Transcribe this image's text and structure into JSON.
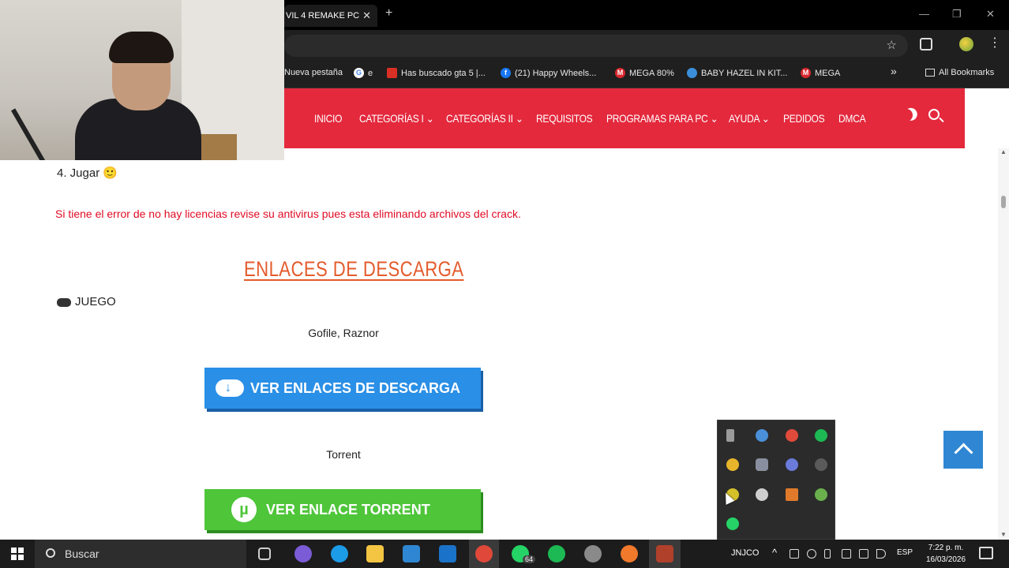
{
  "browser": {
    "tab_title": "VIL 4 REMAKE PC",
    "tab_close": "✕",
    "new_tab": "+",
    "window_controls": [
      "—",
      "❐",
      "✕"
    ],
    "bookmarks": [
      {
        "label": "Nueva pestaña",
        "icon_color": "#1f1f1f"
      },
      {
        "label": "e",
        "icon_color": "#4285f4"
      },
      {
        "label": "Has buscado gta 5 |...",
        "icon_color": "#d93025"
      },
      {
        "label": "(21) Happy Wheels...",
        "icon_color": "#1877f2"
      },
      {
        "label": "MEGA 80%",
        "icon_color": "#d9272e"
      },
      {
        "label": "BABY HAZEL IN KIT...",
        "icon_color": "#3b8fd9"
      },
      {
        "label": "MEGA",
        "icon_color": "#d9272e"
      }
    ],
    "bookmarks_overflow": "»",
    "all_bookmarks": "All Bookmarks"
  },
  "site_nav": {
    "items": [
      "INICIO",
      "CATEGORÍAS I ⌄",
      "CATEGORÍAS II ⌄",
      "REQUISITOS",
      "PROGRAMAS PARA PC ⌄",
      "AYUDA ⌄",
      "PEDIDOS",
      "DMCA"
    ],
    "accent_color": "#e4293d"
  },
  "content": {
    "step4": "4. Jugar 🙂",
    "warning": "Si tiene el error de no hay licencias revise su antivirus pues esta eliminando archivos del crack.",
    "downloads_heading": "ENLACES DE DESCARGA",
    "game_label": "JUEGO",
    "hosts_label": "Gofile, Raznor",
    "download_button": "VER ENLACES DE DESCARGA",
    "torrent_label": "Torrent",
    "torrent_button": "VER ENLACE TORRENT"
  },
  "tray_popup": {
    "icons": [
      {
        "name": "usb-icon",
        "color": "#9a9a9a"
      },
      {
        "name": "settings-app-icon",
        "color": "#4a90d9"
      },
      {
        "name": "antivirus-icon",
        "color": "#e04a3a"
      },
      {
        "name": "spotify-icon",
        "color": "#1db954"
      },
      {
        "name": "chrome-icon",
        "color": "#e7b52c"
      },
      {
        "name": "discord-icon",
        "color": "#8a8fa0"
      },
      {
        "name": "app-icon",
        "color": "#6a7bd9"
      },
      {
        "name": "steam-icon",
        "color": "#5a5a5a"
      },
      {
        "name": "chrome-yellow-icon",
        "color": "#d4c12a"
      },
      {
        "name": "g-hub-icon",
        "color": "#cfcfcf"
      },
      {
        "name": "orange-app-icon",
        "color": "#e07a2a"
      },
      {
        "name": "utorrent-icon",
        "color": "#6ab04c"
      },
      {
        "name": "whatsapp-icon",
        "color": "#25d366"
      }
    ]
  },
  "taskbar": {
    "search_placeholder": "Buscar",
    "apps": [
      {
        "name": "task-view-icon",
        "color": "#cfcfcf"
      },
      {
        "name": "copilot-icon",
        "color": "#7b5cd6"
      },
      {
        "name": "edge-icon",
        "color": "#1c9be6"
      },
      {
        "name": "file-explorer-icon",
        "color": "#f4c542"
      },
      {
        "name": "store-icon",
        "color": "#2f86d2"
      },
      {
        "name": "outlook-icon",
        "color": "#1a73c8"
      },
      {
        "name": "chrome-taskbar-icon",
        "color": "#e0493a"
      },
      {
        "name": "whatsapp-taskbar-icon",
        "color": "#25d366"
      },
      {
        "name": "spotify-taskbar-icon",
        "color": "#1db954"
      },
      {
        "name": "steam-taskbar-icon",
        "color": "#8a8a8a"
      },
      {
        "name": "firefox-icon",
        "color": "#f0792c"
      },
      {
        "name": "game-taskbar-icon",
        "color": "#b0402a"
      }
    ],
    "whatsapp_badge": "64",
    "tray_label": "JNJCO",
    "tray_chevron": "^",
    "language": "ESP",
    "time": "7:22 p. m.",
    "date": "16/03/2026"
  }
}
